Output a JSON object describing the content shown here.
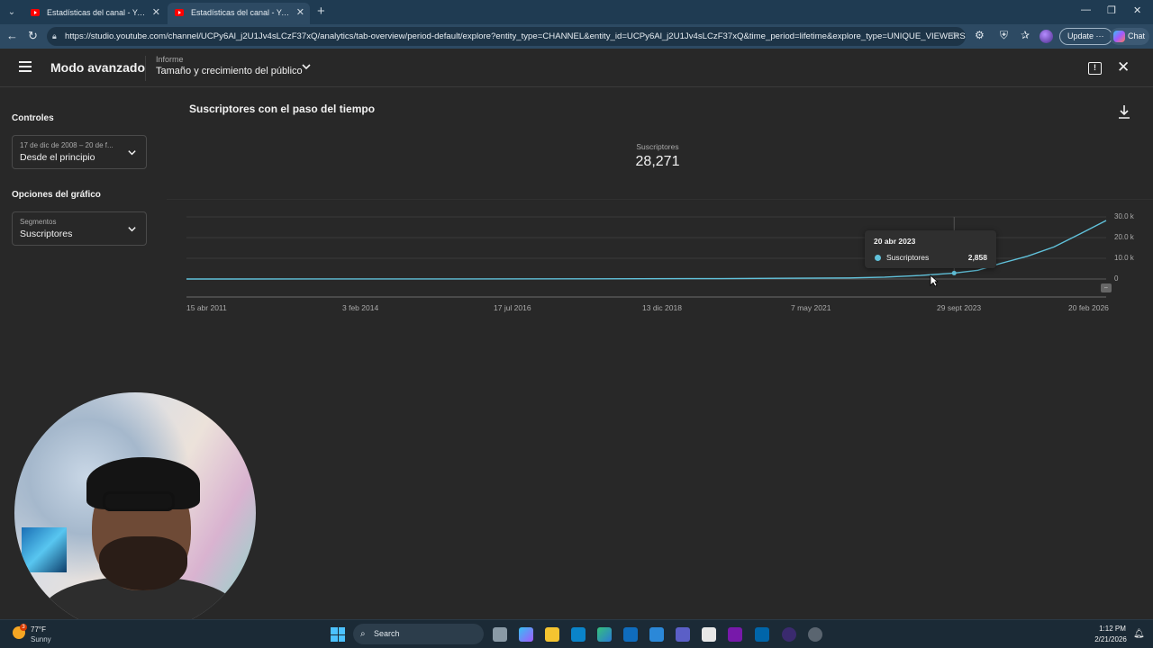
{
  "browser": {
    "tabs": [
      {
        "title": "Estadísticas del canal - YouTube Studio",
        "active": false
      },
      {
        "title": "Estadísticas del canal - YouTube Studio",
        "active": true
      }
    ],
    "url": "https://studio.youtube.com/channel/UCPy6Al_j2U1Jv4sLCzF37xQ/analytics/tab-overview/period-default/explore?entity_type=CHANNEL&entity_id=UCPy6Al_j2U1Jv4sLCzF37xQ&time_period=lifetime&explore_type=UNIQUE_VIEWERS_BY...",
    "update_label": "Update",
    "chat_label": "Chat"
  },
  "header": {
    "mode_title": "Modo avanzado",
    "report_small": "Informe",
    "report_main": "Tamaño y crecimiento del público"
  },
  "sidebar": {
    "controls_heading": "Controles",
    "date_small": "17 de dic de 2008 – 20 de f...",
    "date_main": "Desde el principio",
    "options_heading": "Opciones del gráfico",
    "segments_small": "Segmentos",
    "segments_main": "Suscriptores"
  },
  "main": {
    "chart_title": "Suscriptores con el paso del tiempo",
    "metric_label": "Suscriptores",
    "metric_value": "28,271",
    "tooltip": {
      "date": "20 abr 2023",
      "series": "Suscriptores",
      "value": "2,858"
    }
  },
  "chart_data": {
    "type": "line",
    "x_tick_labels": [
      "15 abr 2011",
      "3 feb 2014",
      "17 jul 2016",
      "13 dic 2018",
      "7 may 2021",
      "29 sept 2023",
      "20 feb 2026"
    ],
    "y_tick_labels": [
      "30.0 k",
      "20.0 k",
      "10.0 k",
      "0"
    ],
    "ylim": [
      0,
      30000
    ],
    "series": [
      {
        "name": "Suscriptores",
        "color": "#61c2db",
        "x": [
          "2008-12-17",
          "2011-04-15",
          "2014-02-03",
          "2016-07-17",
          "2018-12-13",
          "2020-01-01",
          "2021-05-07",
          "2022-01-01",
          "2022-09-01",
          "2023-04-20",
          "2023-09-29",
          "2024-03-01",
          "2024-09-01",
          "2025-03-01",
          "2025-09-01",
          "2026-02-20"
        ],
        "values": [
          0,
          10,
          40,
          100,
          200,
          350,
          500,
          900,
          1700,
          2858,
          4200,
          7500,
          11000,
          15500,
          22000,
          28271
        ]
      }
    ]
  },
  "taskbar": {
    "temperature": "77°F",
    "weather": "Sunny",
    "weather_badge": "3",
    "search_placeholder": "Search",
    "time": "1:12 PM",
    "date": "2/21/2026"
  }
}
